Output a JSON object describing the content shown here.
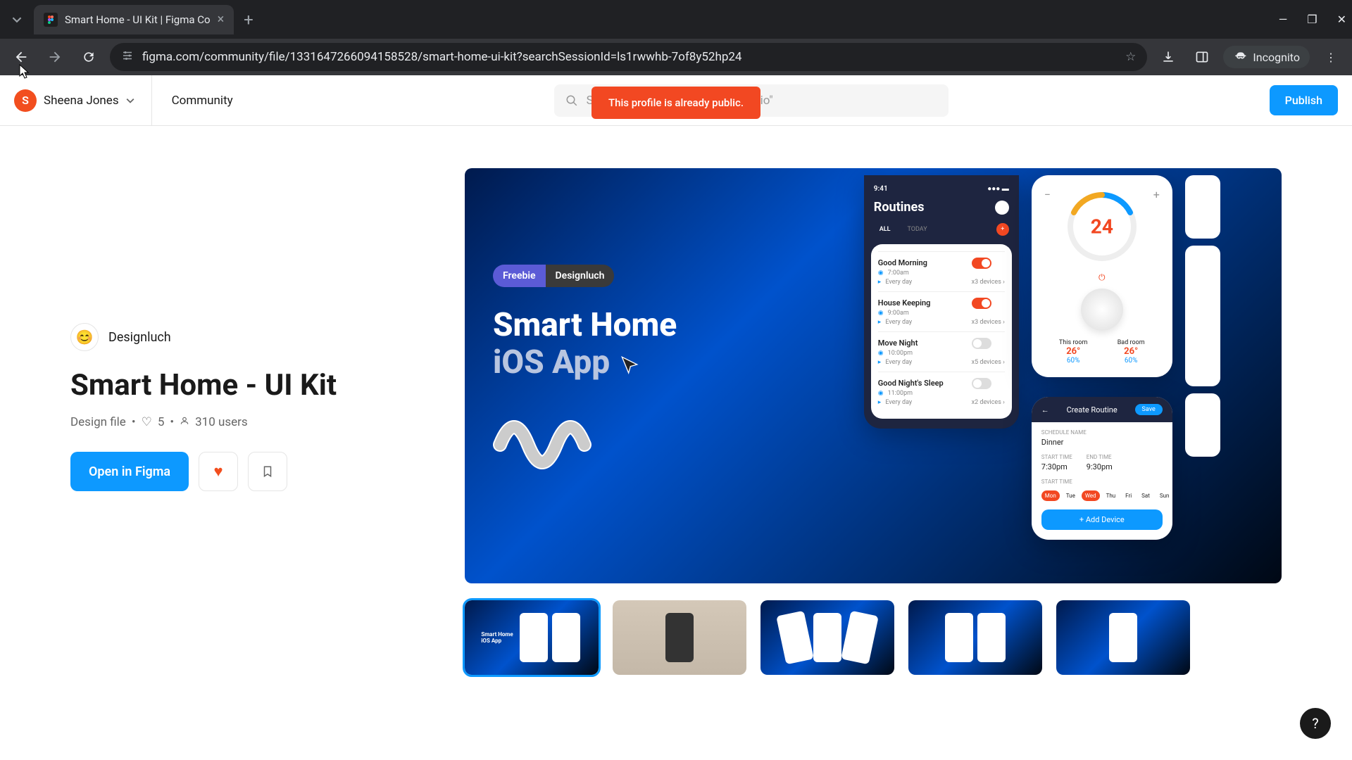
{
  "browser": {
    "tab_title": "Smart Home - UI Kit | Figma Co",
    "url": "figma.com/community/file/1331647266094158528/smart-home-ui-kit?searchSessionId=ls1rwwhb-7of8y52hp24",
    "incognito": "Incognito"
  },
  "header": {
    "user_initial": "S",
    "user_name": "Sheena Jones",
    "community": "Community",
    "search_placeholder": "Search for resources like \"portfolio\"",
    "publish": "Publish"
  },
  "toast": "This profile is already public.",
  "resource": {
    "author": "Designluch",
    "title": "Smart Home - UI Kit",
    "type": "Design file",
    "likes": "5",
    "users": "310 users",
    "open": "Open in Figma"
  },
  "hero": {
    "badge_free": "Freebie",
    "badge_author": "Designluch",
    "title_line1": "Smart Home",
    "title_line2": "iOS App",
    "phone_time": "9:41",
    "routines_title": "Routines",
    "tab_all": "ALL",
    "tab_today": "TODAY",
    "routines": [
      {
        "name": "Good Morning",
        "time": "7:00am",
        "freq": "Every day",
        "devices": "x3 devices",
        "on": true
      },
      {
        "name": "House Keeping",
        "time": "9:00am",
        "freq": "Every day",
        "devices": "x3 devices",
        "on": true
      },
      {
        "name": "Move Night",
        "time": "10:00pm",
        "freq": "Every day",
        "devices": "x5 devices",
        "on": false
      },
      {
        "name": "Good Night's Sleep",
        "time": "11:00pm",
        "freq": "Every day",
        "devices": "x2 devices",
        "on": false
      }
    ],
    "temp": "24",
    "room1": "This room",
    "room2": "Bad room",
    "room1_temp": "26°",
    "room1_hum": "60%",
    "room2_temp": "26°",
    "room2_hum": "60%",
    "create_title": "Create Routine",
    "save": "Save",
    "schedule_label": "SCHEDULE NAME",
    "schedule_name": "Dinner",
    "start_label": "START TIME",
    "end_label": "END TIME",
    "start_time": "7:30pm",
    "end_time": "9:30pm",
    "days": [
      "Mon",
      "Tue",
      "Wed",
      "Thu",
      "Fri",
      "Sat",
      "Sun"
    ],
    "add_device": "+ Add Device"
  }
}
